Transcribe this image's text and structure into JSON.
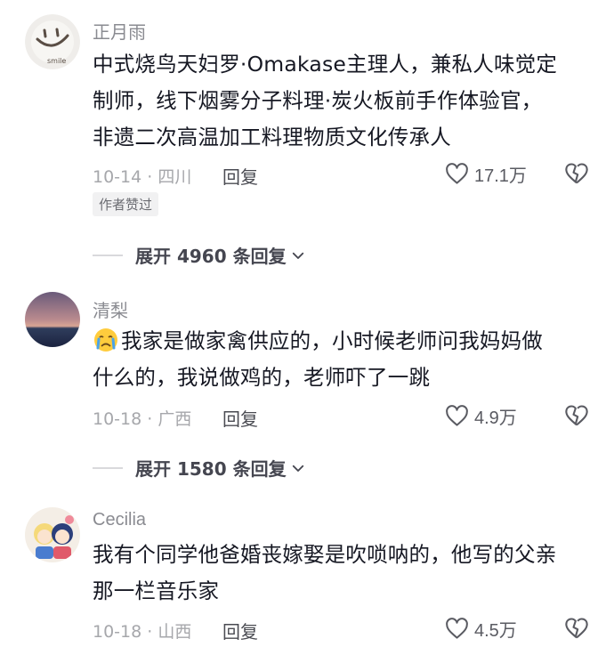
{
  "comments": [
    {
      "username": "正月雨",
      "text_lines": [
        "中式烧鸟天妇罗·Omakase主理人，兼私人味觉定",
        "制师，线下烟雾分子料理·炭火板前手作体验官，",
        "非遗二次高温加工料理物质文化传承人"
      ],
      "date_location": "10-14 · 四川",
      "reply_label": "回复",
      "like_count": "17.1万",
      "badge": "作者赞过",
      "expand_label": "展开 4960 条回复",
      "avatar_text": "smile"
    },
    {
      "username": "清梨",
      "text_lines": [
        "我家是做家禽供应的，小时候老师问我妈妈做",
        "什么的，我说做鸡的，老师吓了一跳"
      ],
      "emoji": "crying-face-emoji",
      "date_location": "10-18 · 广西",
      "reply_label": "回复",
      "like_count": "4.9万",
      "expand_label": "展开 1580 条回复"
    },
    {
      "username": "Cecilia",
      "text_lines": [
        "我有个同学他爸婚丧嫁娶是吹唢呐的，他写的父亲",
        "那一栏音乐家"
      ],
      "date_location": "10-18 · 山西",
      "reply_label": "回复",
      "like_count": "4.5万"
    }
  ],
  "colors": {
    "text": "#161823",
    "secondary": "#8a8b91",
    "meta": "#a6a7ab",
    "badge_bg": "#f1f1f2"
  }
}
